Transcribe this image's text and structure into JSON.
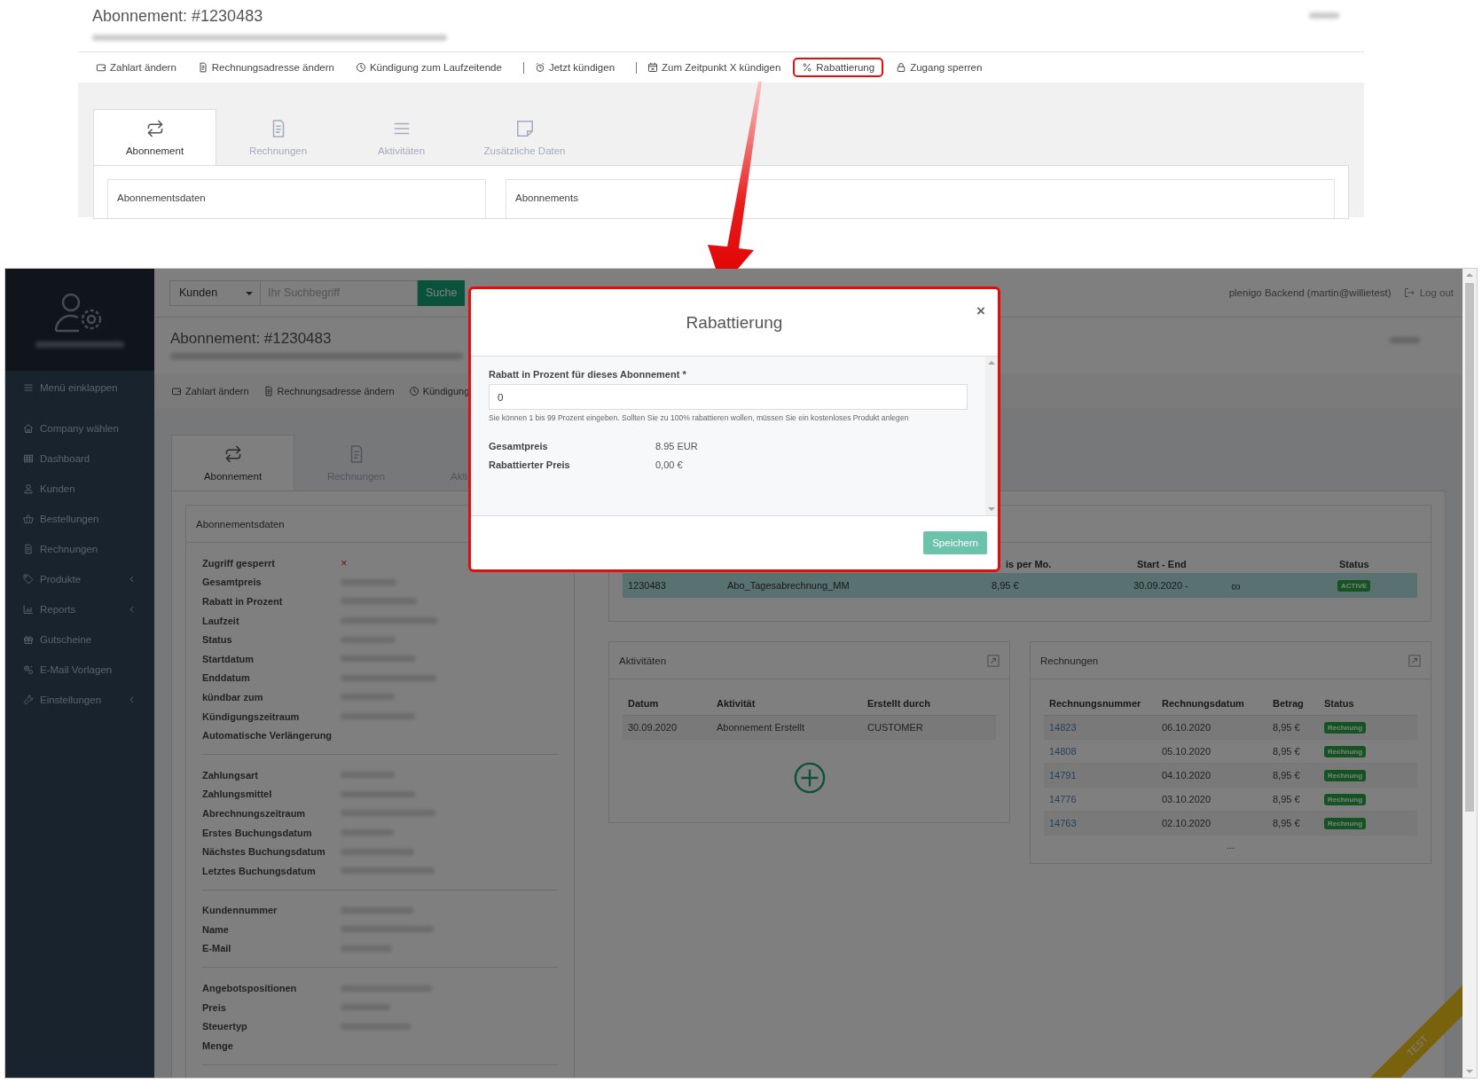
{
  "reference_view": {
    "title": "Abonnement: #1230483",
    "actions": [
      {
        "label": "Zahlart ändern",
        "divider_before": false,
        "highlighted": false
      },
      {
        "label": "Rechnungsadresse ändern",
        "divider_before": false,
        "highlighted": false
      },
      {
        "label": "Kündigung zum Laufzeitende",
        "divider_before": false,
        "highlighted": false
      },
      {
        "label": "Jetzt kündigen",
        "divider_before": true,
        "highlighted": false
      },
      {
        "label": "Zum Zeitpunkt X kündigen",
        "divider_before": true,
        "highlighted": false
      },
      {
        "label": "Rabattierung",
        "divider_before": false,
        "highlighted": true
      },
      {
        "label": "Zugang sperren",
        "divider_before": false,
        "highlighted": false
      }
    ],
    "tabs": [
      {
        "label": "Abonnement",
        "selected": true
      },
      {
        "label": "Rechnungen",
        "selected": false
      },
      {
        "label": "Aktivitäten",
        "selected": false
      },
      {
        "label": "Zusätzliche Daten",
        "selected": false
      }
    ],
    "cards": [
      "Abonnementsdaten",
      "Abonnements"
    ]
  },
  "app": {
    "topbar": {
      "select": "Kunden",
      "placeholder": "Ihr Suchbegriff",
      "button": "Suche",
      "user": "plenigo Backend (martin@willietest)",
      "logout": "Log out"
    },
    "sidebar": {
      "collapse": "Menü einklappen",
      "items": [
        {
          "label": "Company wählen",
          "has_children": false
        },
        {
          "label": "Dashboard",
          "has_children": false
        },
        {
          "label": "Kunden",
          "has_children": false
        },
        {
          "label": "Bestellungen",
          "has_children": false
        },
        {
          "label": "Rechnungen",
          "has_children": false
        },
        {
          "label": "Produkte",
          "has_children": true
        },
        {
          "label": "Reports",
          "has_children": true
        },
        {
          "label": "Gutscheine",
          "has_children": false
        },
        {
          "label": "E-Mail Vorlagen",
          "has_children": false
        },
        {
          "label": "Einstellungen",
          "has_children": true
        }
      ]
    },
    "page": {
      "title": "Abonnement: #1230483",
      "actions": [
        "Zahlart ändern",
        "Rechnungsadresse ändern",
        "Kündigung"
      ],
      "tabs": [
        {
          "label": "Abonnement",
          "selected": true
        },
        {
          "label": "Rechnungen",
          "selected": false
        },
        {
          "label": "Akti",
          "selected": false
        }
      ],
      "details": {
        "title": "Abonnementsdaten",
        "groups": [
          [
            {
              "label": "Zugriff gesperrt",
              "value": "×"
            },
            {
              "label": "Gesamtpreis",
              "redacted": true
            },
            {
              "label": "Rabatt in Prozent",
              "redacted": true
            },
            {
              "label": "Laufzeit",
              "redacted": true
            },
            {
              "label": "Status",
              "redacted": true
            },
            {
              "label": "Startdatum",
              "redacted": true
            },
            {
              "label": "Enddatum",
              "redacted": true
            },
            {
              "label": "kündbar zum",
              "redacted": true
            },
            {
              "label": "Kündigungszeitraum",
              "redacted": true
            },
            {
              "label": "Automatische Verlängerung",
              "redacted": false
            }
          ],
          [
            {
              "label": "Zahlungsart",
              "redacted": true
            },
            {
              "label": "Zahlungsmittel",
              "redacted": true
            },
            {
              "label": "Abrechnungszeitraum",
              "redacted": true
            },
            {
              "label": "Erstes Buchungsdatum",
              "redacted": true
            },
            {
              "label": "Nächstes Buchungsdatum",
              "redacted": true
            },
            {
              "label": "Letztes Buchungsdatum",
              "redacted": true
            }
          ],
          [
            {
              "label": "Kundennummer",
              "redacted": true
            },
            {
              "label": "Name",
              "redacted": true
            },
            {
              "label": "E-Mail",
              "redacted": true
            }
          ],
          [
            {
              "label": "Angebotspositionen",
              "redacted": true
            },
            {
              "label": "Preis",
              "redacted": true
            },
            {
              "label": "Steuertyp",
              "redacted": true
            },
            {
              "label": "Menge",
              "redacted": false
            }
          ]
        ]
      },
      "subscriptions": {
        "header": [
          "is per Mo.",
          "Start - End",
          "Status"
        ],
        "rows": [
          {
            "cells": [
              "1230483",
              "Abo_Tagesabrechnung_MM",
              "8,95 €",
              "30.09.2020 -"
            ],
            "end": "∞",
            "status": "ACTIVE"
          }
        ]
      },
      "activities": {
        "title": "Aktivitäten",
        "columns": [
          "Datum",
          "Aktivität",
          "Erstellt durch"
        ],
        "rows": [
          [
            "30.09.2020",
            "Abonnement Erstellt",
            "CUSTOMER"
          ]
        ]
      },
      "invoices": {
        "title": "Rechnungen",
        "columns": [
          "Rechnungsnummer",
          "Rechnungsdatum",
          "Betrag",
          "Status"
        ],
        "rows": [
          {
            "number": "14823",
            "date": "06.10.2020",
            "amount": "8,95 €",
            "status": "Rechnung"
          },
          {
            "number": "14808",
            "date": "05.10.2020",
            "amount": "8,95 €",
            "status": "Rechnung"
          },
          {
            "number": "14791",
            "date": "04.10.2020",
            "amount": "8,95 €",
            "status": "Rechnung"
          },
          {
            "number": "14776",
            "date": "03.10.2020",
            "amount": "8,95 €",
            "status": "Rechnung"
          },
          {
            "number": "14763",
            "date": "02.10.2020",
            "amount": "8,95 €",
            "status": "Rechnung"
          }
        ],
        "more": "..."
      }
    },
    "modal": {
      "title": "Rabattierung",
      "close": "×",
      "field_label": "Rabatt in Prozent für dieses Abonnement *",
      "value": "0",
      "hint": "Sie können 1 bis 99 Prozent eingeben. Sollten Sie zu 100% rabattieren wollen, müssen Sie ein kostenloses Produkt anlegen",
      "summary": [
        {
          "label": "Gesamtpreis",
          "value": "8.95 EUR"
        },
        {
          "label": "Rabattierter Preis",
          "value": "0,00 €"
        }
      ],
      "save": "Speichern"
    },
    "ribbon": "TEST"
  }
}
